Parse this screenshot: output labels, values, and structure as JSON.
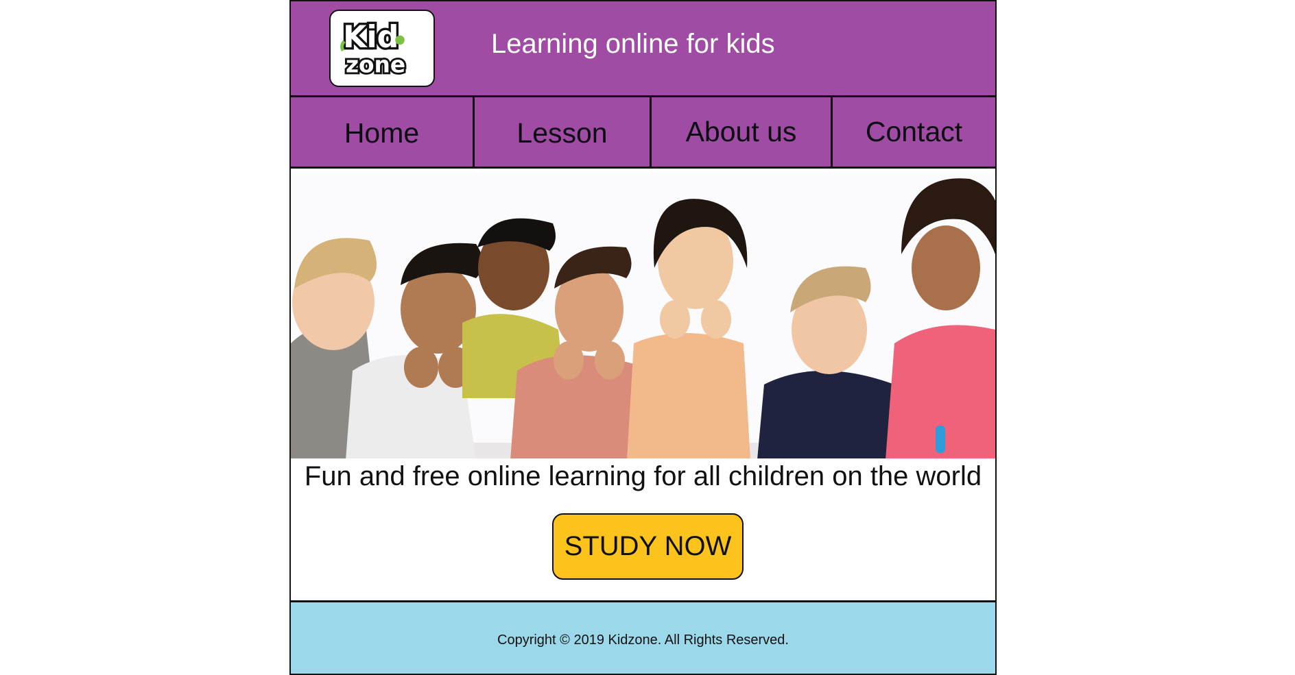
{
  "header": {
    "logo_line1": "Kid",
    "logo_line2": "zone",
    "tagline": "Learning online for kids"
  },
  "nav": {
    "items": [
      {
        "label": "Home"
      },
      {
        "label": "Lesson"
      },
      {
        "label": "About us"
      },
      {
        "label": "Contact"
      }
    ]
  },
  "hero": {
    "image": "group-of-children-photo"
  },
  "main": {
    "headline": "Fun and free online learning for all children on the world",
    "cta_label": "STUDY NOW"
  },
  "footer": {
    "copyright": "Copyright ©  2019 Kidzone. All Rights Reserved."
  },
  "colors": {
    "header_bg": "#a04ba4",
    "cta_bg": "#fbc31b",
    "footer_bg": "#9bd8ea",
    "logo_accent": "#7cc242"
  }
}
